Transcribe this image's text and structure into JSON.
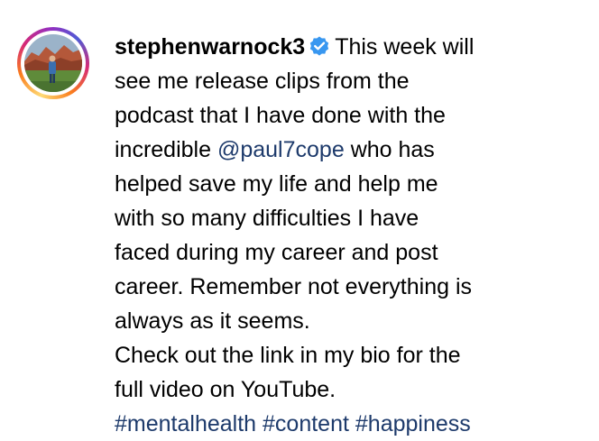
{
  "post": {
    "username": "stephenwarnock3",
    "caption_lines": {
      "l1": "This week will",
      "l2": "see me release clips from the",
      "l3": "podcast that I have done with the",
      "l4_before": "incredible",
      "l4_mention": "@paul7cope",
      "l4_after": "who has",
      "l5": "helped save my life and help me",
      "l6": "with so many difficulties I have",
      "l7": "faced during my career and post",
      "l8": "career. Remember not everything is",
      "l9": "always as it seems.",
      "l10": "Check out the link in my bio for the",
      "l11": "full video on YouTube."
    },
    "hashtags": [
      "#mentalhealth",
      "#content",
      "#happiness"
    ]
  },
  "icons": {
    "verified": "verified-badge-icon",
    "avatar": "profile-avatar"
  },
  "colors": {
    "link": "#1d3a6b",
    "verified": "#3897f0",
    "text": "#000000"
  }
}
